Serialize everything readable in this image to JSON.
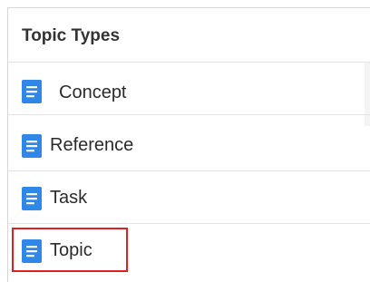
{
  "panel": {
    "title": "Topic Types",
    "items": [
      {
        "label": "Concept",
        "icon": "document-icon"
      },
      {
        "label": "Reference",
        "icon": "document-icon"
      },
      {
        "label": "Task",
        "icon": "document-icon"
      },
      {
        "label": "Topic",
        "icon": "document-icon",
        "selected": true
      }
    ]
  },
  "colors": {
    "icon": "#2f87e8",
    "highlight_border": "#e02020",
    "divider": "#e3e3e3"
  }
}
